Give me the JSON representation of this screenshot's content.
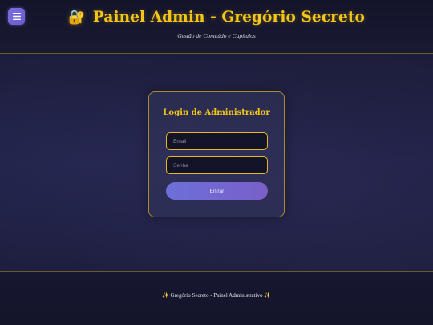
{
  "header": {
    "title_icon": "🔐",
    "title": "Painel Admin - Gregório Secreto",
    "subtitle": "Gestão de Conteúdo e Capítulos",
    "menu_icon": "hamburger-menu-icon"
  },
  "login": {
    "title": "Login de Administrador",
    "email_placeholder": "Email",
    "email_value": "",
    "password_placeholder": "Senha",
    "password_value": "",
    "submit_label": "Entrar"
  },
  "footer": {
    "text": "✨ Gregório Secreto - Painel Administrativo ✨"
  },
  "colors": {
    "accent_gold": "#f5c518",
    "button_purple": "#6d6fd8",
    "background": "#1e2044"
  }
}
